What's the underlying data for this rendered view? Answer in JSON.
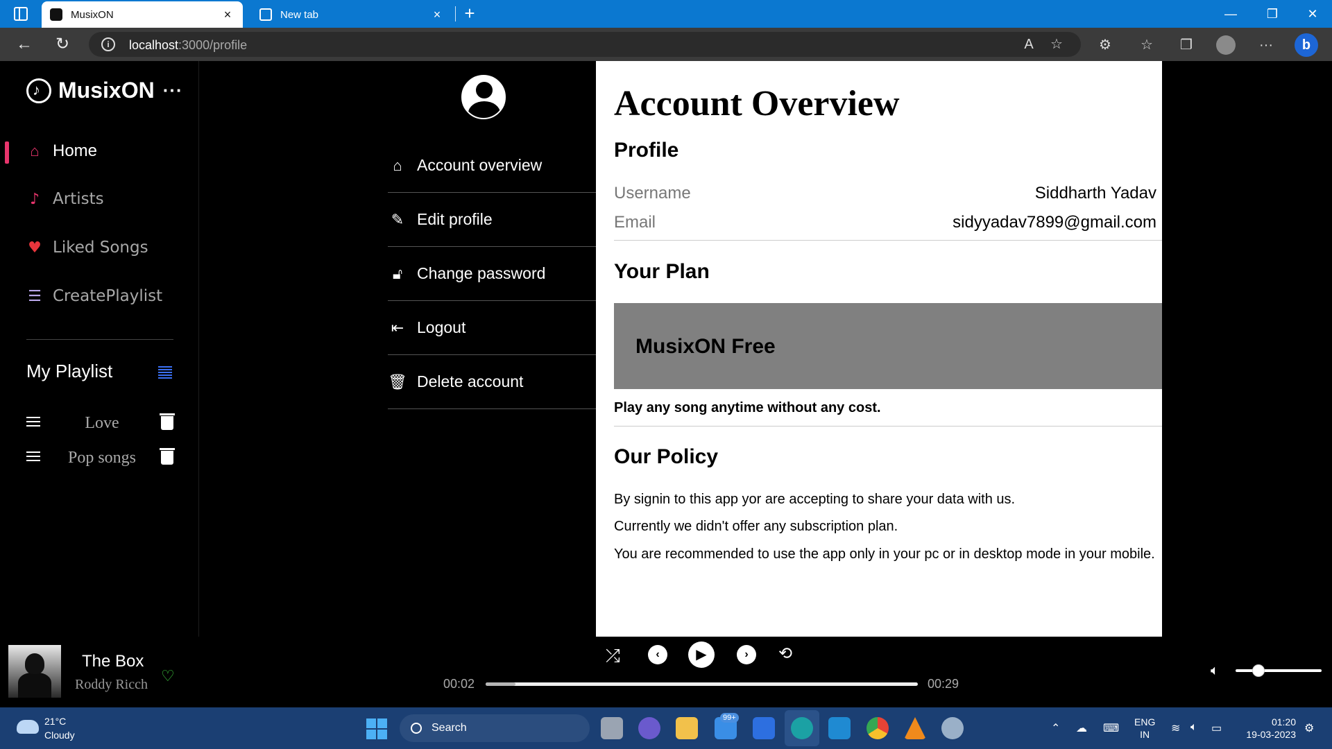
{
  "browser": {
    "tabs": [
      {
        "title": "MusixON",
        "active": true
      },
      {
        "title": "New tab",
        "active": false
      }
    ],
    "tab_close": "×",
    "new_tab": "+",
    "url_host": "localhost",
    "url_path": ":3000/profile",
    "window_controls": {
      "minimize": "—",
      "restore": "❐",
      "close": "✕"
    }
  },
  "sidebar": {
    "brand": "MusixON",
    "brand_more": "···",
    "nav": [
      {
        "label": "Home",
        "icon": "home-icon",
        "active": true
      },
      {
        "label": "Artists",
        "icon": "music-note-icon",
        "active": false
      },
      {
        "label": "Liked Songs",
        "icon": "heart-icon",
        "active": false
      },
      {
        "label": "CreatePlaylist",
        "icon": "add-playlist-icon",
        "active": false
      }
    ],
    "playlist_heading": "My Playlist",
    "playlists": [
      {
        "name": "Love"
      },
      {
        "name": "Pop songs"
      }
    ]
  },
  "profile_menu": {
    "items": [
      {
        "label": "Account overview",
        "icon": "home-icon"
      },
      {
        "label": "Edit profile",
        "icon": "pencil-icon"
      },
      {
        "label": "Change password",
        "icon": "lock-icon"
      },
      {
        "label": "Logout",
        "icon": "logout-icon"
      },
      {
        "label": "Delete account",
        "icon": "trash-icon"
      }
    ]
  },
  "account": {
    "title": "Account Overview",
    "profile_heading": "Profile",
    "fields": [
      {
        "key": "Username",
        "value": "Siddharth Yadav"
      },
      {
        "key": "Email",
        "value": "sidyyadav7899@gmail.com"
      }
    ],
    "plan_heading": "Your Plan",
    "plan_name": "MusixON Free",
    "plan_desc": "Play any song anytime without any cost.",
    "policy_heading": "Our Policy",
    "policy_lines": [
      "By signin to this app yor are accepting to share your data with us.",
      "Currently we didn't offer any subscription plan.",
      "You are recommended to use the app only in your pc or in desktop mode in your mobile."
    ]
  },
  "player": {
    "song_title": "The Box",
    "artist": "Roddy Ricch",
    "current_time": "00:02",
    "duration": "00:29",
    "progress_fraction": 0.069,
    "volume_fraction": 0.27,
    "liked_color": "#3cc43c"
  },
  "taskbar": {
    "temperature": "21°C",
    "condition": "Cloudy",
    "search_label": "Search",
    "mail_badge": "99+",
    "lang_top": "ENG",
    "lang_bottom": "IN",
    "time": "01:20",
    "date": "19-03-2023"
  },
  "colors": {
    "accent_active": "#e8356c",
    "plan_box": "#808080",
    "browser_tabbar": "#0b78d0"
  }
}
